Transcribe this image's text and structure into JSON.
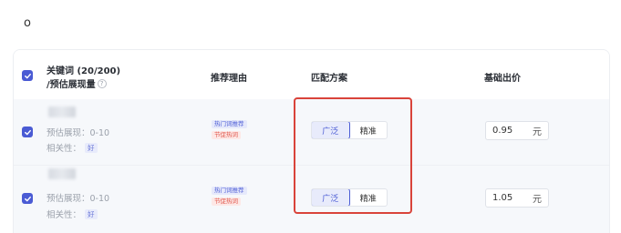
{
  "top_mark": "o",
  "table": {
    "headers": {
      "keyword_line1": "关键词 (20/200)",
      "keyword_line2": "/预估展现量",
      "reason": "推荐理由",
      "match": "匹配方案",
      "bid": "基础出价"
    },
    "rows": [
      {
        "checked": true,
        "estimate": "预估展现：0-10",
        "relevance_label": "相关性：",
        "relevance_value": "好",
        "reasons": [
          "热门词推荐",
          "节促热词"
        ],
        "match_options": [
          "广泛",
          "精准"
        ],
        "match_selected": "广泛",
        "bid_value": "0.95",
        "bid_unit": "元"
      },
      {
        "checked": true,
        "estimate": "预估展现：0-10",
        "relevance_label": "相关性：",
        "relevance_value": "好",
        "reasons": [
          "热门词推荐",
          "节促热词"
        ],
        "match_options": [
          "广泛",
          "精准"
        ],
        "match_selected": "广泛",
        "bid_value": "1.05",
        "bid_unit": "元"
      }
    ]
  },
  "colors": {
    "accent": "#4a5bd4",
    "highlight": "#d9433a",
    "tag_red": "#e0574d"
  }
}
